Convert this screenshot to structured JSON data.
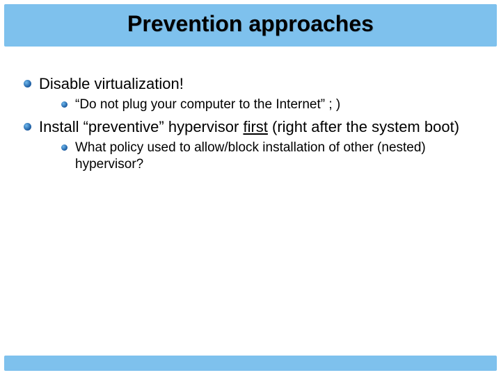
{
  "title": "Prevention approaches",
  "bullets": {
    "b1": "Disable virtualization!",
    "b1_sub1": "“Do not plug your computer to the Internet” ; )",
    "b2_pre": "Install “preventive” hypervisor ",
    "b2_first": "first",
    "b2_post": " (right after the system boot)",
    "b2_sub1": "What policy used to allow/block installation of other (nested) hypervisor?"
  },
  "colors": {
    "band": "#7ec1ed"
  }
}
